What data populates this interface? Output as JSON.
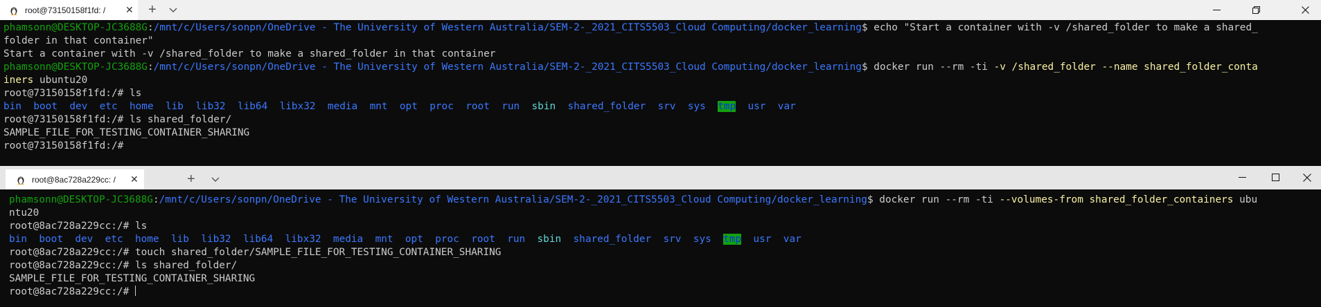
{
  "window1": {
    "tab_title": "root@73150158f1fd: /",
    "new_tab": "+",
    "dropdown": "⌄",
    "controls": [
      "—",
      "❐",
      "✕"
    ],
    "lines": [
      [
        [
          "g",
          "phamsonn@DESKTOP-JC3688G"
        ],
        [
          "w",
          ":"
        ],
        [
          "b",
          "/mnt/c/Users/sonpn/OneDrive - The University of Western Australia/SEM-2-_2021_CITS5503_Cloud Computing/docker_learning"
        ],
        [
          "w",
          "$ echo \"Start a container with -v /shared_folder to make a shared_"
        ]
      ],
      [
        [
          "w",
          "folder in that container\""
        ]
      ],
      [
        [
          "w",
          "Start a container with -v /shared_folder to make a shared_folder in that container"
        ]
      ],
      [
        [
          "g",
          "phamsonn@DESKTOP-JC3688G"
        ],
        [
          "w",
          ":"
        ],
        [
          "b",
          "/mnt/c/Users/sonpn/OneDrive - The University of Western Australia/SEM-2-_2021_CITS5503_Cloud Computing/docker_learning"
        ],
        [
          "w",
          "$ docker run --rm -ti "
        ],
        [
          "y",
          "-v /shared_folder --name shared_folder_conta"
        ]
      ],
      [
        [
          "y",
          "iners"
        ],
        [
          "w",
          " ubuntu20"
        ]
      ],
      [
        [
          "w",
          "root@73150158f1fd:/# ls"
        ]
      ],
      [
        [
          "b",
          "bin"
        ],
        [
          "w",
          "  "
        ],
        [
          "b",
          "boot"
        ],
        [
          "w",
          "  "
        ],
        [
          "b",
          "dev"
        ],
        [
          "w",
          "  "
        ],
        [
          "b",
          "etc"
        ],
        [
          "w",
          "  "
        ],
        [
          "b",
          "home"
        ],
        [
          "w",
          "  "
        ],
        [
          "b",
          "lib"
        ],
        [
          "w",
          "  "
        ],
        [
          "b",
          "lib32"
        ],
        [
          "w",
          "  "
        ],
        [
          "b",
          "lib64"
        ],
        [
          "w",
          "  "
        ],
        [
          "b",
          "libx32"
        ],
        [
          "w",
          "  "
        ],
        [
          "b",
          "media"
        ],
        [
          "w",
          "  "
        ],
        [
          "b",
          "mnt"
        ],
        [
          "w",
          "  "
        ],
        [
          "b",
          "opt"
        ],
        [
          "w",
          "  "
        ],
        [
          "b",
          "proc"
        ],
        [
          "w",
          "  "
        ],
        [
          "b",
          "root"
        ],
        [
          "w",
          "  "
        ],
        [
          "b",
          "run"
        ],
        [
          "w",
          "  "
        ],
        [
          "c",
          "sbin"
        ],
        [
          "w",
          "  "
        ],
        [
          "b",
          "shared_folder"
        ],
        [
          "w",
          "  "
        ],
        [
          "b",
          "srv"
        ],
        [
          "w",
          "  "
        ],
        [
          "b",
          "sys"
        ],
        [
          "w",
          "  "
        ],
        [
          "tmp",
          "tmp"
        ],
        [
          "w",
          "  "
        ],
        [
          "b",
          "usr"
        ],
        [
          "w",
          "  "
        ],
        [
          "b",
          "var"
        ]
      ],
      [
        [
          "w",
          "root@73150158f1fd:/# ls shared_folder/"
        ]
      ],
      [
        [
          "w",
          "SAMPLE_FILE_FOR_TESTING_CONTAINER_SHARING"
        ]
      ],
      [
        [
          "w",
          "root@73150158f1fd:/#"
        ]
      ]
    ]
  },
  "window2": {
    "tab_title": "root@8ac728a229cc: /",
    "new_tab": "+",
    "dropdown": "⌄",
    "controls": [
      "—",
      "☐",
      "✕"
    ],
    "lines": [
      [
        [
          "g",
          "phamsonn@DESKTOP-JC3688G"
        ],
        [
          "w",
          ":"
        ],
        [
          "b",
          "/mnt/c/Users/sonpn/OneDrive - The University of Western Australia/SEM-2-_2021_CITS5503_Cloud Computing/docker_learning"
        ],
        [
          "w",
          "$ docker run --rm -ti "
        ],
        [
          "y",
          "--volumes-from shared_folder_containers"
        ],
        [
          "w",
          " ubu"
        ]
      ],
      [
        [
          "w",
          "ntu20"
        ]
      ],
      [
        [
          "w",
          "root@8ac728a229cc:/# ls"
        ]
      ],
      [
        [
          "b",
          "bin"
        ],
        [
          "w",
          "  "
        ],
        [
          "b",
          "boot"
        ],
        [
          "w",
          "  "
        ],
        [
          "b",
          "dev"
        ],
        [
          "w",
          "  "
        ],
        [
          "b",
          "etc"
        ],
        [
          "w",
          "  "
        ],
        [
          "b",
          "home"
        ],
        [
          "w",
          "  "
        ],
        [
          "b",
          "lib"
        ],
        [
          "w",
          "  "
        ],
        [
          "b",
          "lib32"
        ],
        [
          "w",
          "  "
        ],
        [
          "b",
          "lib64"
        ],
        [
          "w",
          "  "
        ],
        [
          "b",
          "libx32"
        ],
        [
          "w",
          "  "
        ],
        [
          "b",
          "media"
        ],
        [
          "w",
          "  "
        ],
        [
          "b",
          "mnt"
        ],
        [
          "w",
          "  "
        ],
        [
          "b",
          "opt"
        ],
        [
          "w",
          "  "
        ],
        [
          "b",
          "proc"
        ],
        [
          "w",
          "  "
        ],
        [
          "b",
          "root"
        ],
        [
          "w",
          "  "
        ],
        [
          "b",
          "run"
        ],
        [
          "w",
          "  "
        ],
        [
          "c",
          "sbin"
        ],
        [
          "w",
          "  "
        ],
        [
          "b",
          "shared_folder"
        ],
        [
          "w",
          "  "
        ],
        [
          "b",
          "srv"
        ],
        [
          "w",
          "  "
        ],
        [
          "b",
          "sys"
        ],
        [
          "w",
          "  "
        ],
        [
          "tmp",
          "tmp"
        ],
        [
          "w",
          "  "
        ],
        [
          "b",
          "usr"
        ],
        [
          "w",
          "  "
        ],
        [
          "b",
          "var"
        ]
      ],
      [
        [
          "w",
          "root@8ac728a229cc:/# touch shared_folder/SAMPLE_FILE_FOR_TESTING_CONTAINER_SHARING"
        ]
      ],
      [
        [
          "w",
          "root@8ac728a229cc:/# ls shared_folder/"
        ]
      ],
      [
        [
          "w",
          "SAMPLE_FILE_FOR_TESTING_CONTAINER_SHARING"
        ]
      ],
      [
        [
          "w",
          "root@8ac728a229cc:/# "
        ]
      ]
    ]
  },
  "colors": {
    "green": "#13a10e",
    "blue": "#3b78ff",
    "yellow": "#f9f1a5",
    "cyan": "#61d6d6",
    "text": "#cccccc",
    "background": "#0c0c0c"
  },
  "icons": {
    "tab_icon": "tux-linux-icon",
    "close": "close-icon",
    "new_tab": "plus-icon",
    "dropdown": "chevron-down-icon",
    "minimize": "minimize-icon",
    "maximize": "maximize-icon"
  }
}
